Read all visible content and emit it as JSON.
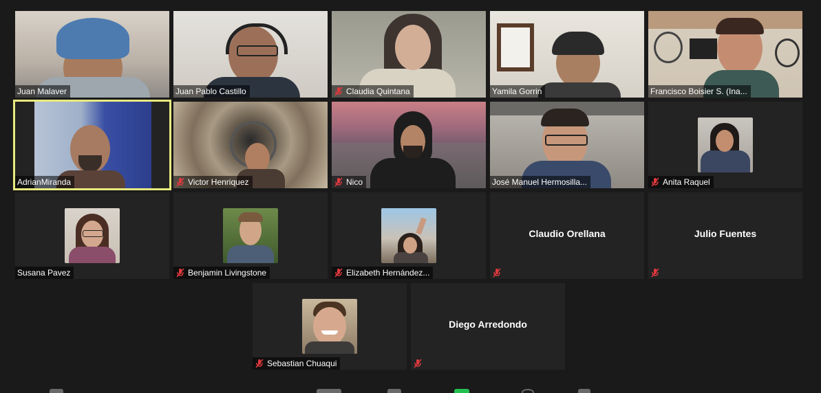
{
  "participants": [
    {
      "name": "Juan Malaver",
      "muted": false
    },
    {
      "name": "Juan Pablo Castillo",
      "muted": false
    },
    {
      "name": "Claudia Quintana",
      "muted": true
    },
    {
      "name": "Yamila Gorrin",
      "muted": false
    },
    {
      "name": "Francisco Boisier S. (Ina...",
      "muted": false
    },
    {
      "name": "AdrianMiranda",
      "muted": false,
      "active_speaker": true
    },
    {
      "name": "Victor Henriquez",
      "muted": true
    },
    {
      "name": "Nico",
      "muted": true
    },
    {
      "name": "José Manuel Hermosilla...",
      "muted": false
    },
    {
      "name": "Anita Raquel",
      "muted": true
    },
    {
      "name": "Susana Pavez",
      "muted": false
    },
    {
      "name": "Benjamin Livingstone",
      "muted": true
    },
    {
      "name": "Elizabeth Hernández...",
      "muted": true
    },
    {
      "name": "Claudio Orellana",
      "muted": true,
      "video_off": true
    },
    {
      "name": "Julio Fuentes",
      "muted": true,
      "video_off": true
    },
    {
      "name": "Sebastian Chuaqui",
      "muted": true
    },
    {
      "name": "Diego Arredondo",
      "muted": true,
      "video_off": true
    }
  ],
  "colors": {
    "background": "#1a1a1a",
    "tile": "#232323",
    "active_speaker_border": "#e8ea7e",
    "muted_icon": "#e0393e"
  }
}
